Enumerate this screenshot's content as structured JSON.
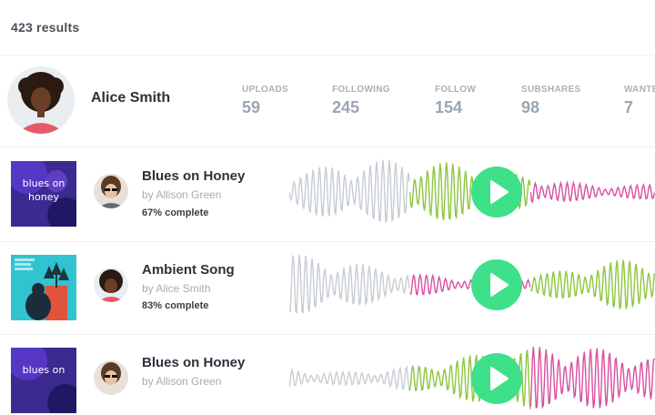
{
  "results": {
    "count_label": "423 results"
  },
  "profile": {
    "name": "Alice Smith",
    "stats": [
      {
        "label": "UPLOADS",
        "value": "59"
      },
      {
        "label": "FOLLOWING",
        "value": "245"
      },
      {
        "label": "FOLLOW",
        "value": "154"
      },
      {
        "label": "SUBSHARES",
        "value": "98"
      },
      {
        "label": "WANTE",
        "value": "7"
      }
    ]
  },
  "tracks": [
    {
      "title": "Blues on Honey",
      "artist": "by Allison Green",
      "progress_label": "67% complete",
      "progress": 0.67,
      "cover_text": "blues on honey",
      "cover_theme": "purple",
      "wave_colors": [
        "#c7cdd3",
        "#8cc63f",
        "#d94fa0"
      ]
    },
    {
      "title": "Ambient Song",
      "artist": "by Alice Smith",
      "progress_label": "83% complete",
      "progress": 0.83,
      "cover_text": "",
      "cover_theme": "teal",
      "wave_colors": [
        "#c7cdd3",
        "#d94fa0",
        "#8cc63f"
      ]
    },
    {
      "title": "Blues on Honey",
      "artist": "by Allison Green",
      "progress_label": "",
      "progress": 0.67,
      "cover_text": "blues on",
      "cover_theme": "purple",
      "wave_colors": [
        "#c7cdd3",
        "#8cc63f",
        "#d94fa0"
      ]
    }
  ],
  "icons": {
    "play": "play-icon"
  },
  "colors": {
    "play_button": "#3ee08a",
    "accent_green": "#8cc63f",
    "accent_pink": "#d94fa0",
    "wave_grey": "#c7cdd3"
  }
}
